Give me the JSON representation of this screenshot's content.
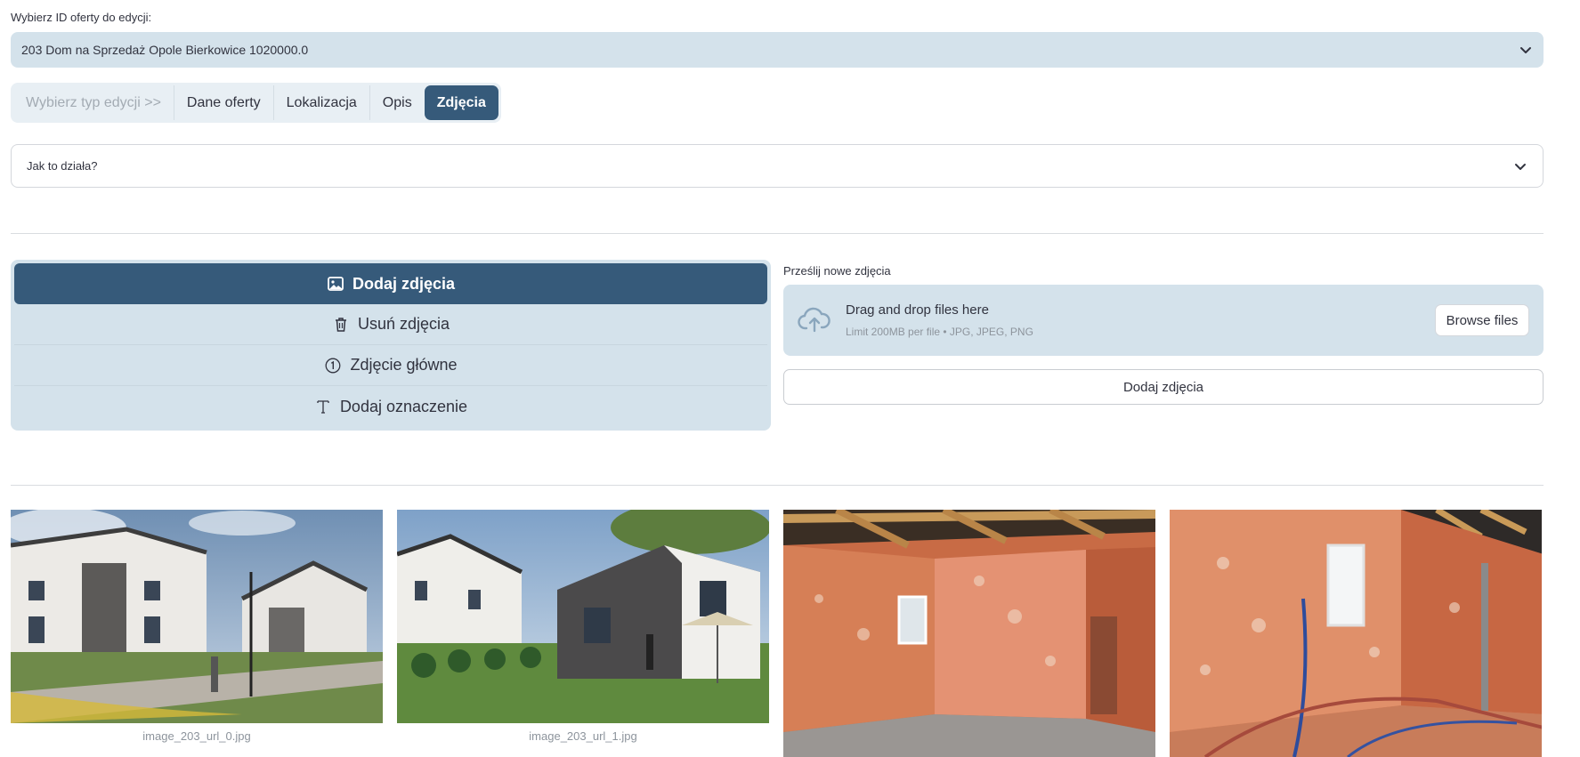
{
  "select": {
    "label": "Wybierz ID oferty do edycji:",
    "value": "203 Dom na Sprzedaż Opole Bierkowice 1020000.0"
  },
  "tabs": [
    {
      "label": "Wybierz typ edycji >>",
      "state": "disabled"
    },
    {
      "label": "Dane oferty",
      "state": "normal"
    },
    {
      "label": "Lokalizacja",
      "state": "normal"
    },
    {
      "label": "Opis",
      "state": "normal"
    },
    {
      "label": "Zdjęcia",
      "state": "active"
    }
  ],
  "expander": {
    "label": "Jak to działa?"
  },
  "menu": {
    "items": [
      {
        "label": "Dodaj zdjęcia",
        "icon": "image-icon",
        "active": true
      },
      {
        "label": "Usuń zdjęcia",
        "icon": "trash-icon",
        "active": false
      },
      {
        "label": "Zdjęcie główne",
        "icon": "circled-one-icon",
        "active": false
      },
      {
        "label": "Dodaj oznaczenie",
        "icon": "text-icon",
        "active": false
      }
    ]
  },
  "upload": {
    "label": "Prześlij nowe zdjęcia",
    "drag_text": "Drag and drop files here",
    "limit_text": "Limit 200MB per file • JPG, JPEG, PNG",
    "browse_label": "Browse files",
    "submit_label": "Dodaj zdjęcia"
  },
  "gallery": [
    {
      "caption": "image_203_url_0.jpg"
    },
    {
      "caption": "image_203_url_1.jpg"
    },
    {
      "caption": ""
    },
    {
      "caption": ""
    }
  ],
  "colors": {
    "primary": "#365a7a",
    "panel": "#d4e2eb",
    "muted_text": "#8d949c"
  }
}
